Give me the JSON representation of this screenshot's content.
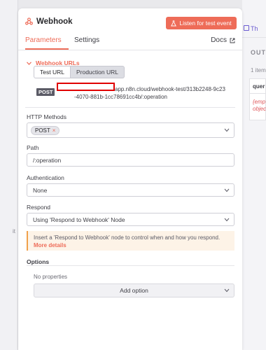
{
  "background": {
    "left_fragment": "it",
    "right_tab_label": "Th",
    "output_title": "OUT",
    "output_items": "1 item",
    "output_header": "quer",
    "output_cell_line1": "{emp",
    "output_cell_line2": "objec"
  },
  "header": {
    "title": "Webhook",
    "listen_button": "Listen for test event"
  },
  "tabs": {
    "parameters": "Parameters",
    "settings": "Settings",
    "docs": "Docs"
  },
  "webhook_urls": {
    "section_label": "Webhook URLs",
    "test_tab": "Test URL",
    "production_tab": "Production URL",
    "method_badge": "POST",
    "url_line1": "app.n8n.cloud/webhook-test/313b2248-9c23",
    "url_line2": "-4070-881b-1cc78691cc4b/:operation"
  },
  "http_methods": {
    "label": "HTTP Methods",
    "chip": "POST",
    "chip_remove": "×"
  },
  "path": {
    "label": "Path",
    "value": "/:operation"
  },
  "authentication": {
    "label": "Authentication",
    "value": "None"
  },
  "respond": {
    "label": "Respond",
    "value": "Using 'Respond to Webhook' Node"
  },
  "notice": {
    "text": "Insert a 'Respond to Webhook' node to control when and how you respond.",
    "link": "More details"
  },
  "options": {
    "label": "Options",
    "empty_text": "No properties",
    "add_button": "Add option"
  },
  "colors": {
    "accent": "#ee6c58",
    "warning_border": "#f0a04b",
    "warning_bg": "#fdf3e7"
  }
}
